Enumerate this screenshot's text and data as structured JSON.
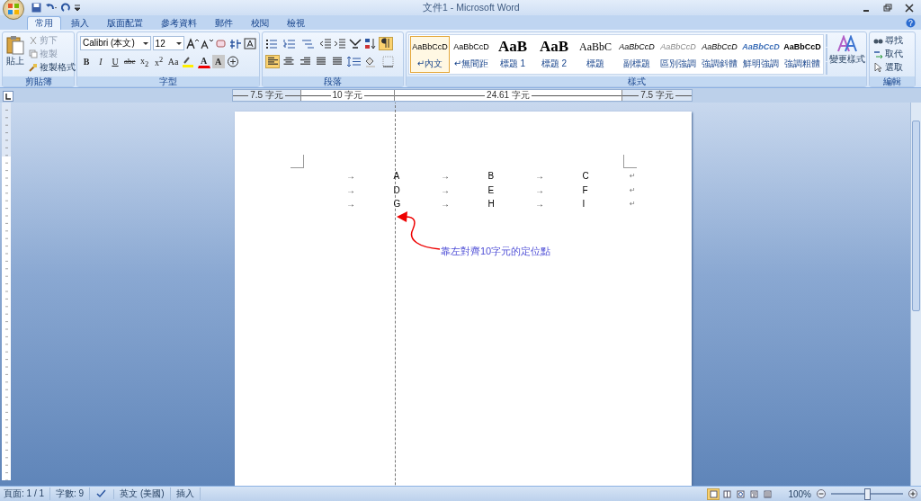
{
  "window": {
    "title": "文件1 - Microsoft Word"
  },
  "tabs": [
    {
      "label": "常用",
      "selected": true
    },
    {
      "label": "插入",
      "selected": false
    },
    {
      "label": "版面配置",
      "selected": false
    },
    {
      "label": "參考資料",
      "selected": false
    },
    {
      "label": "郵件",
      "selected": false
    },
    {
      "label": "校閱",
      "selected": false
    },
    {
      "label": "檢視",
      "selected": false
    }
  ],
  "clipboard": {
    "paste": "貼上",
    "cut": "剪下",
    "copy": "複製",
    "format_painter": "複製格式",
    "label": "剪貼簿"
  },
  "font": {
    "family": "Calibri (本文)",
    "size": "12",
    "label": "字型",
    "format_buttons": [
      "B",
      "I",
      "U",
      "abe",
      "x$_{2}$",
      "x$^{2}$",
      "Aa"
    ],
    "font_color": "A",
    "shading": "A"
  },
  "paragraph": {
    "label": "段落",
    "show_marks": true,
    "alignments": [
      {
        "kind": "left",
        "selected": true
      },
      {
        "kind": "center",
        "selected": false
      },
      {
        "kind": "right",
        "selected": false
      },
      {
        "kind": "justify",
        "selected": false
      },
      {
        "kind": "distributed",
        "selected": false
      }
    ]
  },
  "styles": {
    "label": "樣式",
    "items": [
      {
        "sample": "AaBbCcD",
        "name": "↵內文",
        "kind": "normal",
        "selected": true
      },
      {
        "sample": "AaBbCcD",
        "name": "↵無間距",
        "kind": "normal",
        "selected": false
      },
      {
        "sample": "AaB",
        "name": "標題 1",
        "kind": "heading",
        "selected": false
      },
      {
        "sample": "AaB",
        "name": "標題 2",
        "kind": "heading",
        "selected": false
      },
      {
        "sample": "AaBbC",
        "name": "標題",
        "kind": "title",
        "selected": false
      },
      {
        "sample": "AaBbCcD",
        "name": "副標題",
        "kind": "italic",
        "selected": false
      },
      {
        "sample": "AaBbCcD",
        "name": "區別強調",
        "kind": "subtle",
        "selected": false
      },
      {
        "sample": "AaBbCcD",
        "name": "強調斜體",
        "kind": "italic",
        "selected": false
      },
      {
        "sample": "AaBbCcD",
        "name": "鮮明強調",
        "kind": "intense",
        "selected": false
      },
      {
        "sample": "AaBbCcD",
        "name": "強調粗體",
        "kind": "strong",
        "selected": false
      }
    ]
  },
  "change_styles": "變更樣式",
  "editing": {
    "label": "編輯",
    "items": [
      {
        "kind": "find",
        "label": "尋找"
      },
      {
        "kind": "replace",
        "label": "取代"
      },
      {
        "kind": "select",
        "label": "選取"
      }
    ]
  },
  "ruler": [
    "7.5 字元",
    "10 字元",
    "24.61 字元",
    "7.5 字元"
  ],
  "document": {
    "rows": [
      {
        "cells": [
          "→",
          "A",
          "→",
          "B",
          "→",
          "C"
        ],
        "mark": "↵"
      },
      {
        "cells": [
          "→",
          "D",
          "→",
          "E",
          "→",
          "F"
        ],
        "mark": "↵"
      },
      {
        "cells": [
          "→",
          "G",
          "→",
          "H",
          "→",
          "I"
        ],
        "mark": "↵"
      }
    ],
    "annotation": "靠左對齊10字元的定位點"
  },
  "status_bar": {
    "page": "頁面: 1 / 1",
    "words": "字數: 9",
    "language": "英文 (美國)",
    "mode": "插入",
    "views": [
      {
        "kind": "print",
        "selected": true
      },
      {
        "kind": "reading",
        "selected": false
      },
      {
        "kind": "web",
        "selected": false
      },
      {
        "kind": "outline",
        "selected": false
      },
      {
        "kind": "draft",
        "selected": false
      }
    ],
    "zoom": "100%",
    "zoom_level": {
      "level": 0.5
    }
  }
}
